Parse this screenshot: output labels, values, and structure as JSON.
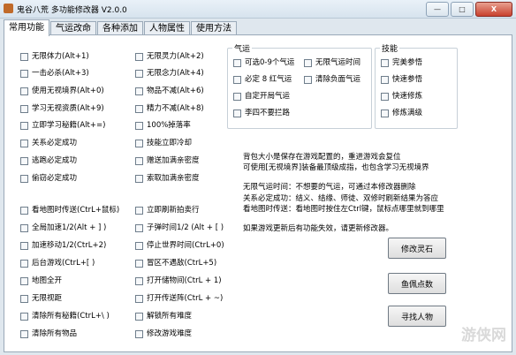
{
  "window": {
    "title": "鬼谷八荒 多功能修改器  V2.0.0",
    "buttons": {
      "minimize": "—",
      "maximize": "□",
      "close": "X"
    }
  },
  "tabs": [
    {
      "label": "常用功能",
      "active": true
    },
    {
      "label": "气运改命"
    },
    {
      "label": "各种添加"
    },
    {
      "label": "人物属性"
    },
    {
      "label": "使用方法"
    }
  ],
  "col1": [
    "无限体力(Alt+1)",
    "一击必杀(Alt+3)",
    "使用无视境界(Alt+0)",
    "学习无视资质(Alt+9)",
    "立即学习秘籍(Alt+=)",
    "关系必定成功",
    "逃跑必定成功",
    "偷窃必定成功",
    "看地图时传送(CtrL+鼠标)",
    "全局加速1/2(Alt + ] )",
    "加速移动1/2(CtrL+2)",
    "后台游戏(CtrL+[ )",
    "地图全开",
    "无限视距",
    "清除所有秘籍(CtrL+\\ )",
    "清除所有物品"
  ],
  "col2": [
    "无限灵力(Alt+2)",
    "无限念力(Alt+4)",
    "物品不减(Alt+6)",
    "精力不减(Alt+8)",
    "100%掉落率",
    "技能立即冷却",
    "赠送加满亲密度",
    "索取加满亲密度",
    "立即刷新拍卖行",
    "子弹时间1/2 (Alt + [ )",
    "停止世界时间(CtrL+0)",
    "冒区不遇敌(CtrL+5)",
    "打开储物间(CtrL + 1)",
    "打开传送阵(CtrL + ~)",
    "解锁所有难度",
    "修改游戏难度"
  ],
  "luck_group": {
    "title": "气运",
    "items": [
      "可选0-9个气运",
      "无限气运时间",
      "必定 8 红气运",
      "清除负面气运",
      "自定开局气运",
      "李四不要拦路"
    ]
  },
  "skill_group": {
    "title": "技能",
    "items": [
      "完美参悟",
      "快速参悟",
      "快速修炼",
      "修炼满级"
    ]
  },
  "notes": [
    "背包大小是保存在游戏配置的，重进游戏会复位",
    "可使用[无视境界]装备最顶级成指，也包含学习无视境界",
    "",
    "无限气运时间：不想要的气运，可通过本修改器删除",
    "关系必定成功：结义、结缘、师徒、双修时刷新结果为答应",
    "看地图时传送：看地图时按住左Ctrl键，鼠标点哪里就到哪里",
    "",
    "如果游戏更新后有功能失效，请更新修改器。"
  ],
  "buttons": {
    "fix_stone": "修改灵石",
    "fish_points": "鱼佩点数",
    "find_person": "寻找人物"
  },
  "watermark": "游侠网"
}
